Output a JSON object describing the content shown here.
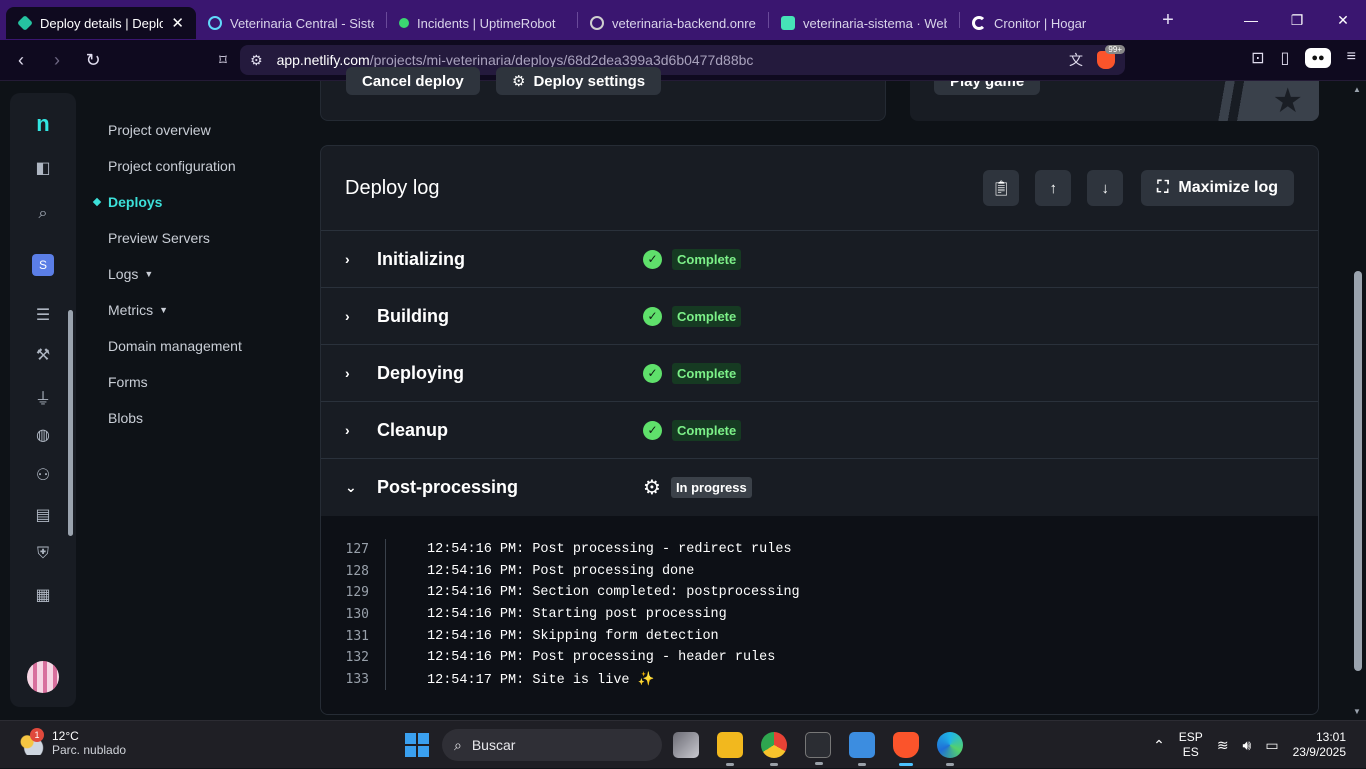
{
  "browser": {
    "tabs": [
      {
        "title": "Deploy details | Deploy",
        "active": true,
        "color": "#25c2a0"
      },
      {
        "title": "Veterinaria Central - Sistem",
        "active": false,
        "color": "#61dafb"
      },
      {
        "title": "Incidents | UptimeRobot",
        "active": false,
        "color": "#3bd671"
      },
      {
        "title": "veterinaria-backend.onrend",
        "active": false,
        "color": "#cfcfcf"
      },
      {
        "title": "veterinaria-sistema · Web",
        "active": false,
        "color": "#46e3b7"
      },
      {
        "title": "Cronitor | Hogar",
        "active": false,
        "color": "#ffffff"
      }
    ],
    "url_host": "app.netlify.com",
    "url_path": "/projects/mi-veterinaria/deploys/68d2dea399a3d6b0477d88bc",
    "ext_badge": "99+"
  },
  "rail": {
    "logo": "n",
    "team_initial": "S"
  },
  "subnav": {
    "items": [
      {
        "label": "Project overview"
      },
      {
        "label": "Project configuration"
      },
      {
        "label": "Deploys",
        "active": true
      },
      {
        "label": "Preview Servers"
      },
      {
        "label": "Logs",
        "caret": true
      },
      {
        "label": "Metrics",
        "caret": true
      },
      {
        "label": "Domain management"
      },
      {
        "label": "Forms"
      },
      {
        "label": "Blobs"
      }
    ]
  },
  "top_cards": {
    "cancel_label": "Cancel deploy",
    "settings_label": "Deploy settings",
    "game_label": "Play game"
  },
  "deploy_log": {
    "title": "Deploy log",
    "maximize_label": "Maximize log",
    "steps": [
      {
        "name": "Initializing",
        "status": "Complete",
        "expanded": false
      },
      {
        "name": "Building",
        "status": "Complete",
        "expanded": false
      },
      {
        "name": "Deploying",
        "status": "Complete",
        "expanded": false
      },
      {
        "name": "Cleanup",
        "status": "Complete",
        "expanded": false
      },
      {
        "name": "Post-processing",
        "status": "In progress",
        "expanded": true
      }
    ],
    "lines": [
      {
        "n": "127",
        "text": "12:54:16 PM: Post processing - redirect rules"
      },
      {
        "n": "128",
        "text": "12:54:16 PM: Post processing done"
      },
      {
        "n": "129",
        "text": "12:54:16 PM: Section completed: postprocessing"
      },
      {
        "n": "130",
        "text": "12:54:16 PM: Starting post processing"
      },
      {
        "n": "131",
        "text": "12:54:16 PM: Skipping form detection"
      },
      {
        "n": "132",
        "text": "12:54:16 PM: Post processing - header rules"
      },
      {
        "n": "133",
        "text": "12:54:17 PM: Site is live ✨"
      }
    ]
  },
  "taskbar": {
    "weather_temp": "12°C",
    "weather_desc": "Parc. nublado",
    "weather_badge": "1",
    "search_label": "Buscar",
    "lang_1": "ESP",
    "lang_2": "ES",
    "time": "13:01",
    "date": "23/9/2025"
  }
}
